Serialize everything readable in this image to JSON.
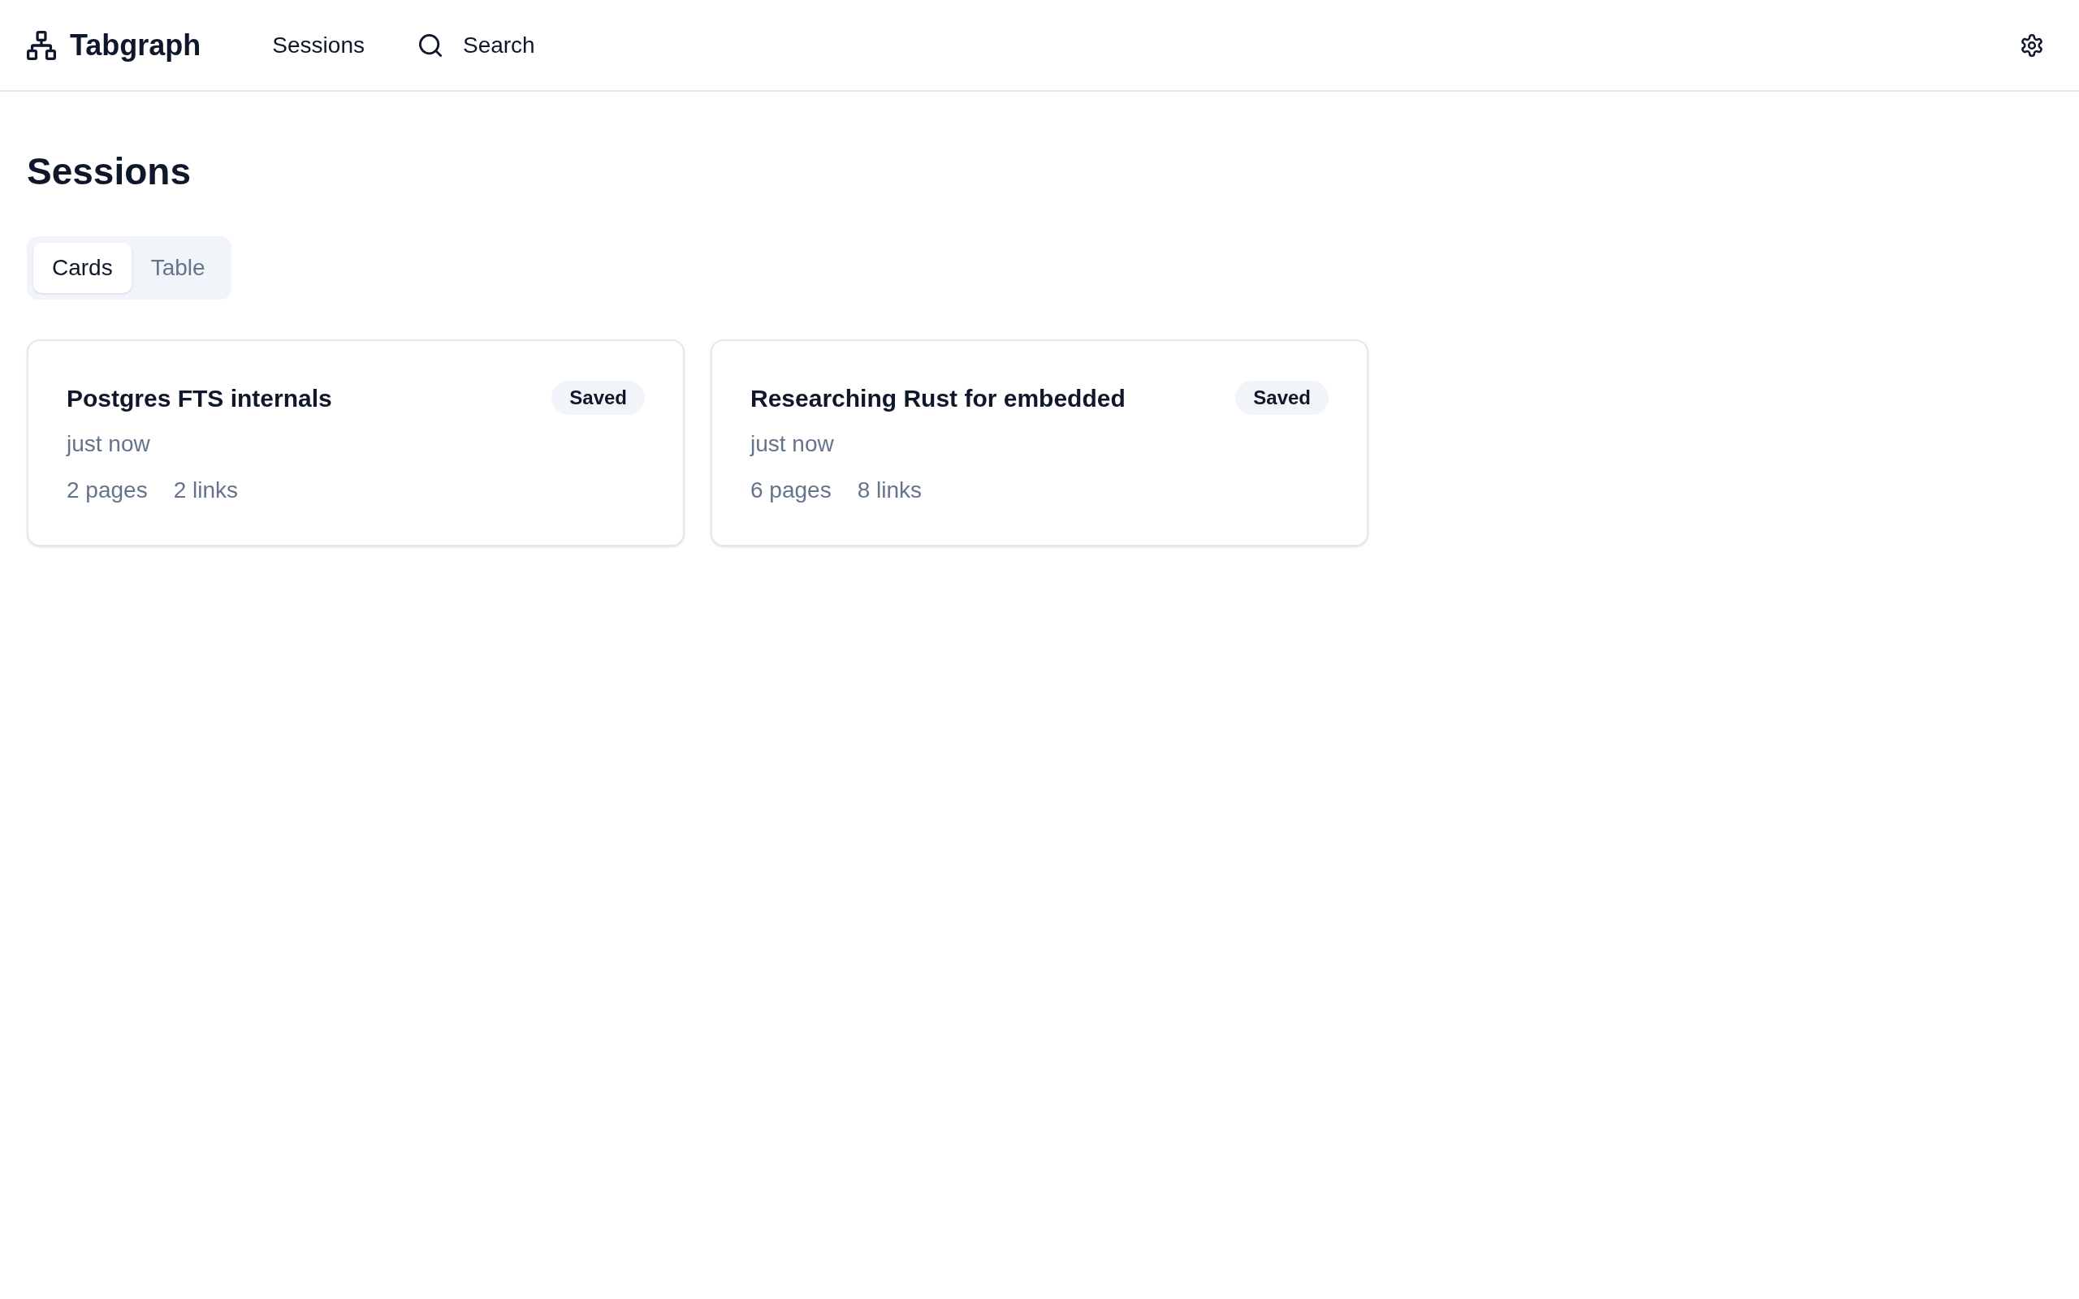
{
  "header": {
    "brand": "Tabgraph",
    "nav": [
      {
        "label": "Sessions",
        "kind": "link"
      },
      {
        "label": "Search",
        "kind": "search"
      }
    ]
  },
  "page": {
    "title": "Sessions",
    "view_tabs": [
      {
        "label": "Cards",
        "selected": true
      },
      {
        "label": "Table",
        "selected": false
      }
    ]
  },
  "sessions": [
    {
      "title": "Postgres FTS internals",
      "status": "Saved",
      "time": "just now",
      "pages": "2 pages",
      "links": "2 links"
    },
    {
      "title": "Researching Rust for embedded",
      "status": "Saved",
      "time": "just now",
      "pages": "6 pages",
      "links": "8 links"
    }
  ]
}
